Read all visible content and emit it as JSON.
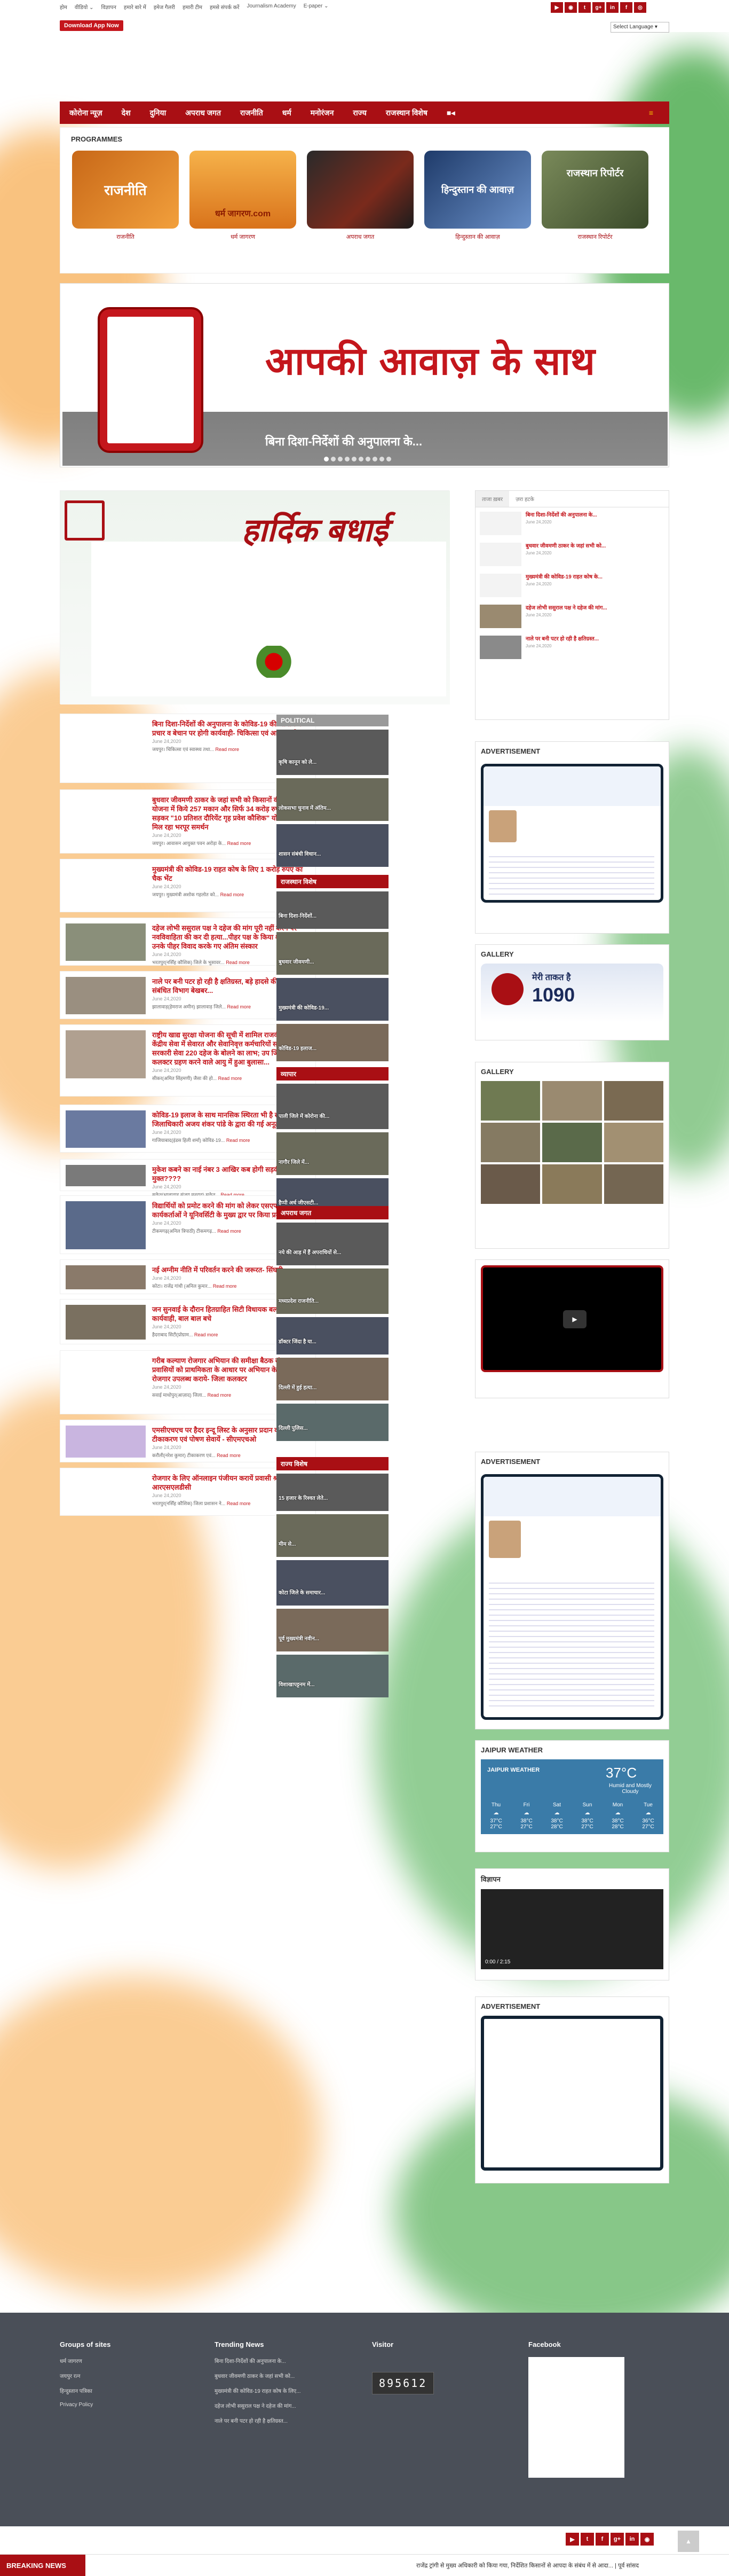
{
  "top_nav": [
    "होम",
    "वीडियो ⌄",
    "विज्ञापन",
    "हमारे बारे में",
    "इमेज गैलरी",
    "हमारी टीम",
    "हमसे संपर्क करें",
    "Journalism Academy",
    "E-paper ⌄"
  ],
  "social_icons": [
    "youtube-icon",
    "rss-icon",
    "twitter-icon",
    "google-plus-icon",
    "linkedin-icon",
    "facebook-icon",
    "instagram-icon"
  ],
  "download_label": "Download App Now",
  "lang_select": "Select Language ▾",
  "main_nav": [
    "कोरोना न्यूज़",
    "देश",
    "दुनिया",
    "अपराध जगत",
    "राजनीति",
    "धर्म",
    "मनोरंजन",
    "राज्य",
    "राजस्थान विशेष"
  ],
  "programmes": {
    "title": "PROGRAMMES",
    "items": [
      {
        "label": "राजनीति",
        "art": "राजनीति",
        "color": "#c86818"
      },
      {
        "label": "धर्म जागरण",
        "art": "धर्म जागरण.com",
        "color": "#e18a2a"
      },
      {
        "label": "अपराध जगत",
        "art": "",
        "color": "#5a2a1c"
      },
      {
        "label": "हिन्दुस्तान की आवाज़",
        "art": "हिन्दुस्तान की आवाज़",
        "color": "#2c4a7a"
      },
      {
        "label": "राजस्थान रिपोर्टर",
        "art": "राजस्थान रिपोर्टर",
        "color": "#5a6a40"
      }
    ]
  },
  "banner": {
    "headline": "आपकी आवाज़ के साथ",
    "sub": "बिना दिशा-निर्देशों की अनुपालना के..."
  },
  "feature": {
    "title": "हार्दिक बधाई"
  },
  "news": [
    {
      "title": "बिना दिशा-निर्देशों की अनुपालना के कोविड-19 की औषधि के प्रचार व बेचान पर होगी कार्यवाही- चिकित्सा एवं आयुष मंत्री",
      "date": "June 24,2020",
      "excerpt": "जयपुर। चिकित्सा एवं स्वास्थ्य तथा...",
      "more": "Read more"
    },
    {
      "title": "बुधवार जीवमणी ठाकर के जहां सभी को किसानों की आवास योजना में किये 257 मकान और सिर्फ 34 करोड़ रुपये का सड़कर \"10 प्रतिशत दौरियेंट गृह प्रवेश कौशिक\" योजना को मिल रहा भरपूर समर्थन",
      "date": "June 24,2020",
      "excerpt": "जयपुर। आवासन आयुक्त पवन अरोड़ा के...",
      "more": "Read more"
    },
    {
      "title": "मुख्यमंत्री की कोविड-19 राहत कोष के लिए 1 करोड़ रुपए का चैक भेंट",
      "date": "June 24,2020",
      "excerpt": "जयपुर। मुख्यमंत्री अशोक गहलोत को...",
      "more": "Read more"
    },
    {
      "title": "दहेज लोभी ससुराल पक्ष ने दहेज की मांग पूरी नहीं करने पर नवविवाहिता की कर दी हत्या...पीहर पक्ष के किया शवदाह में उनके पीहर विवाद करके गए अंतिम संस्कार",
      "date": "June 24,2020",
      "excerpt": "भरतपुर(नर्सिंह कौशिक) जिले के भुसावर...",
      "more": "Read more"
    },
    {
      "title": "नाले पर बनी पटर हो रही है क्षतिग्रस्त, बड़े हादसे की संभावना, संबंधित विभाग बेखबर...",
      "date": "June 24,2020",
      "excerpt": "झालावाड़(हेमराज अमीन) झालावाड़ जिले...",
      "more": "Read more"
    },
    {
      "title": "राष्ट्रीय खाद्य सुरक्षा योजना की सूची में शामिल राजकीय व केंद्रीय सेवा में सेवारत और सेवानिवृत्त कर्मचारियों सहित अनेक सरकारी सेवा 220 दहेज के बोलने का लाभ; उप जिला कलक्टर ग्रहण करने वाले आयु में हुआ बुलासा...",
      "date": "June 24,2020",
      "excerpt": "सीकर(अमित सिंहमणी) जैसा की हो...",
      "more": "Read more"
    },
    {
      "title": "कोविड-19 इलाज के साथ मानसिक स्थिरता भी है सहायक, जिलाधिकारी अजय शंकर पांडे के द्वारा की गई अनूठी पहल...",
      "date": "June 24,2020",
      "excerpt": "गाजियाबाद(इंडस हिली शर्मा) कोविड-19...",
      "more": "Read more"
    },
    {
      "title": "मुकेश कबने का नाई नंबर 3 आखिर कब होगी सड़की मुक्त????",
      "date": "June 24,2020",
      "excerpt": "सुकेत(भालावाड़ संजय मनराव) सुकेत...",
      "more": "Read more"
    },
    {
      "title": "विद्यार्थियों को प्रमोट करने की मांग को लेकर एसएफआई कार्यकर्ताओं ने यूनिवर्सिटी के मुख्य द्वार पर किया प्रदर्शन...",
      "date": "June 24,2020",
      "excerpt": "टीकमगढ़(अनिल त्रिपाठी) टीकमगढ़...",
      "more": "Read more"
    },
    {
      "title": "नई अग्नीम नीति में परिवर्तन करने की जरूरत- सिंघवी",
      "date": "June 24,2020",
      "excerpt": "कोटा। राजेंद्र गांधी (अनिल कुमार...",
      "more": "Read more"
    },
    {
      "title": "जन सुनवाई के दौरान हितग्राहित सिटी विधायक बलदेवीलाल पर कार्यवाही, बाल बाल बचे",
      "date": "June 24,2020",
      "excerpt": "हैदराबाद सिटी(प्रोग्राम...",
      "more": "Read more"
    },
    {
      "title": "गरीब कल्याण रोजगार अभियान की समीक्षा बैठक संपन्न प्रवासियों को प्राथमिकता के आधार पर अभियान के तहत रोजगार उपलब्ध कराये- जिला कलक्टर",
      "date": "June 24,2020",
      "excerpt": "सवाई माधोपुर(आज़ाद) जिला...",
      "more": "Read more"
    },
    {
      "title": "एमसीएचएच पर हैदर इन्दू लिस्ट के अनुसार प्रदान की जाए टीकाकरण एवं पोषण सेवायें - सीएमएचओ",
      "date": "June 24,2020",
      "excerpt": "करौली(नरेश कुमार) टीकाकरण एवं...",
      "more": "Read more"
    },
    {
      "title": "रोजगार के लिए ऑनलाइन पंजीयन करायें प्रवासी श्रमिक: आरएसएलडीसी",
      "date": "June 24,2020",
      "excerpt": "भरतपुर(नर्सिंह कौशिक) जिला प्रशासन ने...",
      "more": "Read more"
    }
  ],
  "mid_sections": [
    {
      "title": "POLITICAL",
      "captions": [
        "कृषि कानून को ले...",
        "लोकसभा चुनाव में अंतिम...",
        "शासन संबंधी विधान..."
      ]
    },
    {
      "title": "राजस्थान विशेष",
      "captions": [
        "बिना दिशा-निर्देशों...",
        "बुधवार जीवमणी...",
        "मुख्यमंत्री की कोविड-19...",
        "कोविड-19 इलाज..."
      ]
    },
    {
      "title": "व्यापार",
      "captions": [
        "पाली जिले में कोरोना की...",
        "नागौर जिले में...",
        "हैप्पी अर्ध जीएसटी..."
      ]
    },
    {
      "title": "अपराध जगत",
      "captions": [
        "नये की आड़ में हैं अपराधियों से...",
        "मध्यप्रदेश राजनीति...",
        "डॉक्टर जिंदा है या...",
        "दिल्ली में हुई हत्या...",
        "दिल्ली पुलिस..."
      ]
    },
    {
      "title": "राज्य विशेष",
      "captions": [
        "15 हजार के रिश्वत लेते...",
        "मीम से...",
        "कोटा जिले के समाचार...",
        "पूर्व मुख्यमंत्री नवीन...",
        "विशाखापट्टनम में..."
      ]
    }
  ],
  "sidebar": {
    "tabs": [
      "ताजा ख़बर",
      "ज़रा हटके"
    ],
    "recent": [
      {
        "title": "बिना दिशा-निर्देशों की अनुपालना के...",
        "date": "June 24,2020"
      },
      {
        "title": "बुधवार जीवमणी ठाकर के जहां सभी को...",
        "date": "June 24,2020"
      },
      {
        "title": "मुख्यमंत्री की कोविड-19 राहत कोष के...",
        "date": "June 24,2020"
      },
      {
        "title": "दहेज लोभी ससुराल पक्ष ने दहेज की मांग...",
        "date": "June 24,2020"
      },
      {
        "title": "नाले पर बनी पटर हो रही है क्षतिग्रस्त...",
        "date": "June 24,2020"
      }
    ],
    "ad_title": "ADVERTISEMENT",
    "gallery_title": "GALLERY",
    "helpline": "1090",
    "helpline_text": "मेरी ताकत है",
    "weather_title": "JAIPUR WEATHER",
    "weather": {
      "city": "JAIPUR WEATHER",
      "temp": "37°C",
      "cond": "Humid and Mostly Cloudy",
      "days": [
        "Thu",
        "Fri",
        "Sat",
        "Sun",
        "Mon",
        "Tue"
      ],
      "highs": [
        "37°C",
        "38°C",
        "38°C",
        "38°C",
        "38°C",
        "36°C"
      ],
      "lows": [
        "27°C",
        "27°C",
        "28°C",
        "27°C",
        "28°C",
        "27°C"
      ]
    },
    "video_title": "विज्ञापन",
    "video_time": "0:00 / 2:15"
  },
  "footer": {
    "groups_title": "Groups of sites",
    "groups": [
      "धर्म जागरण",
      "जयपुर रत्न",
      "हिन्दुस्तान पत्रिका",
      "Privacy Policy"
    ],
    "trending_title": "Trending News",
    "trending": [
      "बिना दिशा-निर्देशों की अनुपालना के...",
      "बुधवार जीवमणी ठाकर के जहां सभी को...",
      "मुख्यमंत्री की कोविड-19 राहत कोष के लिए...",
      "दहेज लोभी ससुराल पक्ष ने दहेज की मांग...",
      "नाले पर बनी पटर हो रही है क्षतिग्रस्त..."
    ],
    "visitor_title": "Visitor",
    "visitor_count": "895612",
    "facebook_title": "Facebook"
  },
  "breaking": {
    "label": "BREAKING NEWS",
    "text": "राजेंद्र ट्रांगी से मुख्य अधिकारी को किया गया, निर्देशित किसानों से आपदा के संबंध में से आदा... | पूर्व सांसद"
  }
}
